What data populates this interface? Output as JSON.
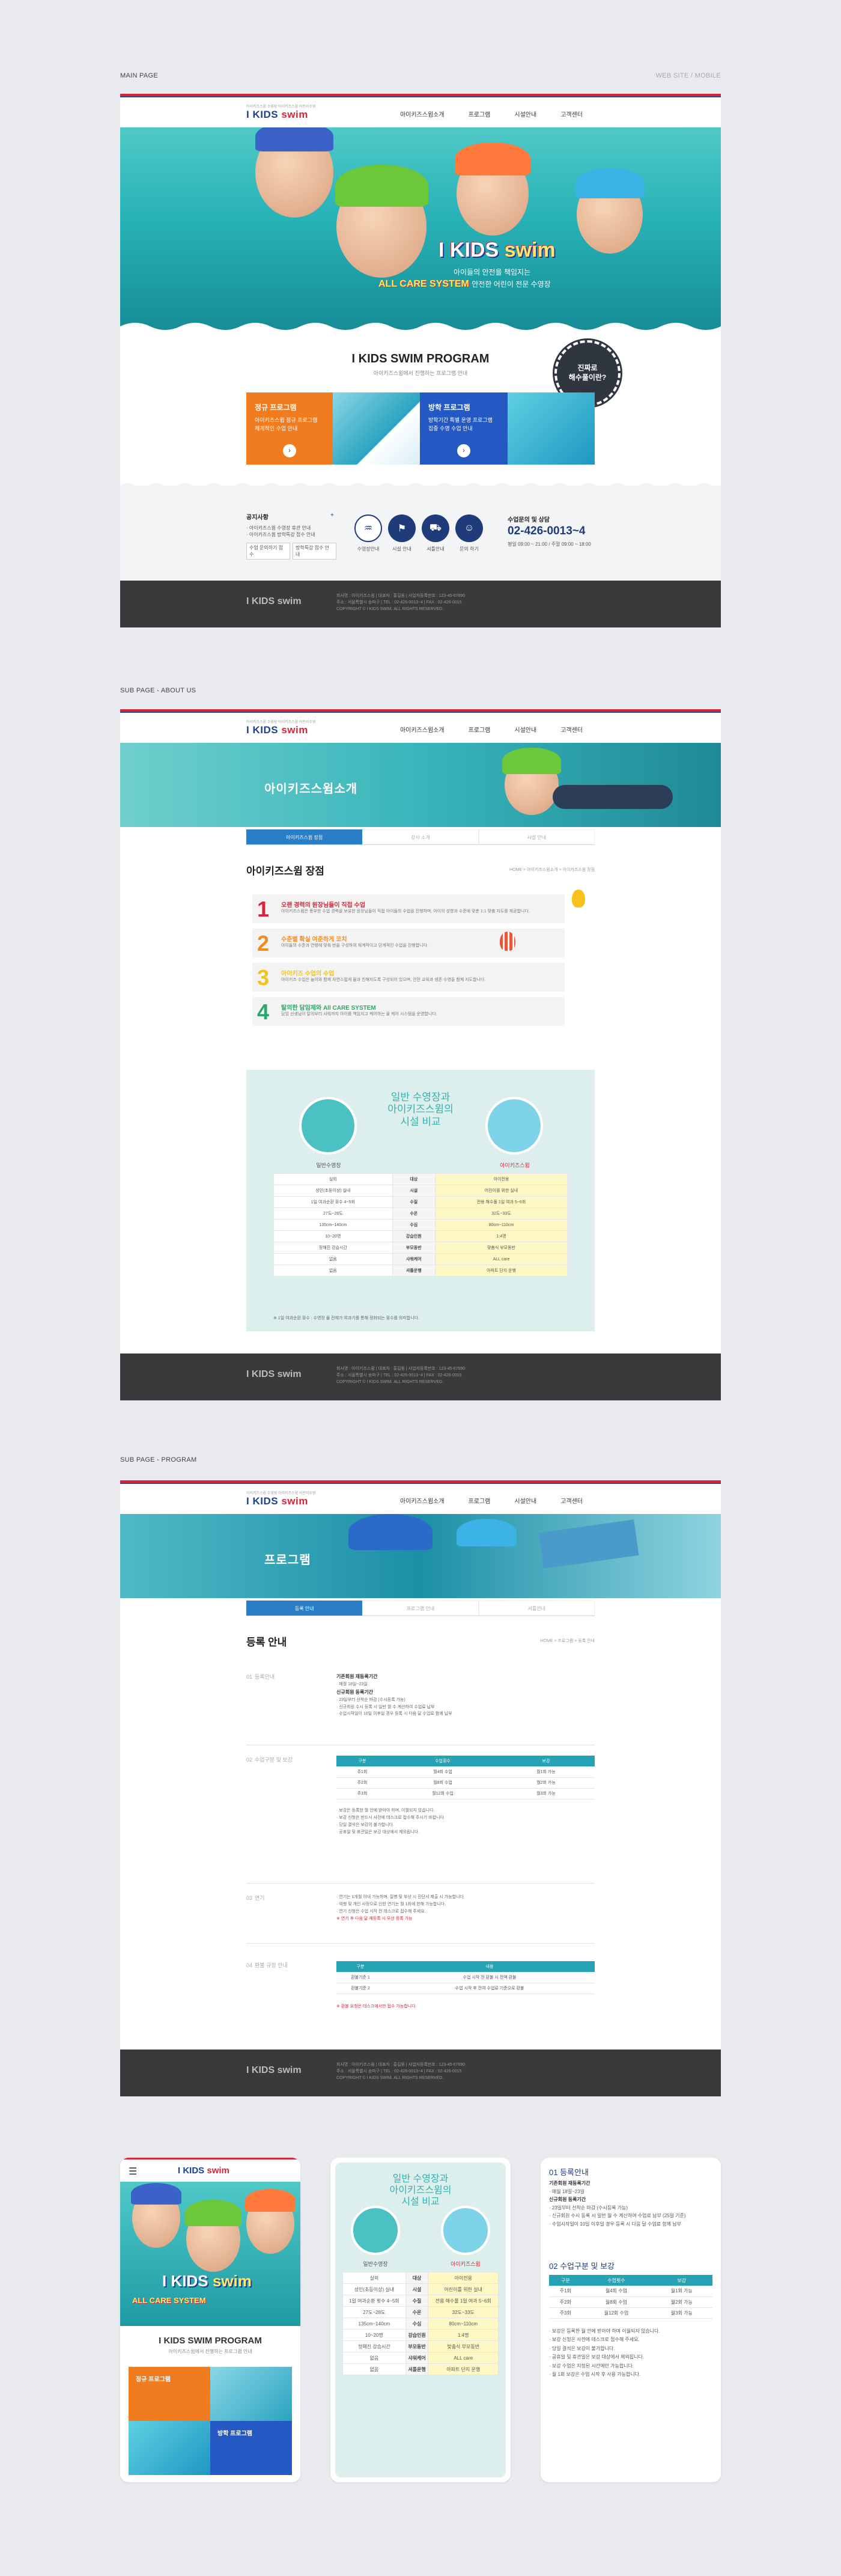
{
  "sections": {
    "main_label": "MAIN PAGE",
    "main_right": "WEB SITE / MOBILE",
    "about_label": "SUB PAGE - ABOUT US",
    "program_label": "SUB PAGE - PROGRAM"
  },
  "header": {
    "logo_small": "아이키즈스윔 수영장 아이키즈스윔 어린이수영",
    "logo_i": "I",
    "logo_kids": "KIDS",
    "logo_swim": "swim",
    "nav": [
      "아이키즈스윔소개",
      "프로그램",
      "시설안내",
      "고객센터"
    ]
  },
  "hero": {
    "brand_i": "I",
    "brand_kids": "KIDS",
    "brand_swim": "swim",
    "copy1": "아이들의 안전을 책임지는",
    "copy2_main": "ALL CARE SYSTEM",
    "copy2_sub": "안전한 어린이 전문 수영장"
  },
  "program": {
    "title": "I KIDS SWIM PROGRAM",
    "subtitle": "아이키즈스윔에서 진행하는 프로그램 안내",
    "badge": "진짜로\n해수풀이란?",
    "card1_title": "정규 프로그램",
    "card1_desc": "아이키즈스윔 정규 프로그램\n체계적인 수업 안내",
    "card2_title": "방학 프로그램",
    "card2_desc": "방학기간 특별 운영 프로그램\n집중 수영 수업 안내",
    "go": "›"
  },
  "info": {
    "notice_title": "공지사항",
    "notice_lines": [
      "· 아이키즈스윔 수영장 휴관 안내",
      "· 아이키즈스윔 방학특강 접수 안내"
    ],
    "notice_btn1": "수업 문의하기 접수",
    "notice_btn2": "방학특강 접수 안내",
    "quick": [
      {
        "icon": "swim-icon",
        "glyph": "♒",
        "label": "수영장안내"
      },
      {
        "icon": "flag-icon",
        "glyph": "⚑",
        "label": "시설 안내"
      },
      {
        "icon": "bus-icon",
        "glyph": "⛟",
        "label": "셔틀안내"
      },
      {
        "icon": "user-icon",
        "glyph": "☺",
        "label": "문의 하기"
      }
    ],
    "phone_label": "수업문의 및 상담",
    "phone": "02-426-0013~4",
    "phone_hours": "평일 09:00 ~ 21:00 / 주말 09:00 ~ 18:00"
  },
  "footer": {
    "logo": "I KIDS swim",
    "line1": "회사명 : 아이키즈스윔  |  대표자 : 홍길동  |  사업자등록번호 : 123-45-67890",
    "line2": "주소 : 서울특별시 송파구  |  TEL : 02-426-0013~4  |  FAX : 02-426-0015",
    "line3": "COPYRIGHT © I KIDS SWIM. ALL RIGHTS RESERVED."
  },
  "about": {
    "hero_title": "아이키즈스윔소개",
    "tabs": [
      "아이키즈스윔 장점",
      "강사 소개",
      "시설 안내"
    ],
    "page_title": "아이키즈스윔 장점",
    "crumb": "HOME > 아이키즈스윔소개 > 아이키즈스윔 장점",
    "steps": [
      {
        "n": "1",
        "title": "오랜 경력의 원장님들이 직접 수업",
        "desc": "아이키즈스윔은 풍부한 수업 경력을 보유한 원장님들이 직접 아이들의 수업을 진행하며, 아이의 성향과 수준에 맞춘 1:1 맞춤 지도를 제공합니다.",
        "color": "#d6263b"
      },
      {
        "n": "2",
        "title": "수준별 확실 여준하게 코치",
        "desc": "아이들의 수준과 연령에 맞춰 반을 구성하여 체계적이고 단계적인 수업을 진행합니다.",
        "color": "#f08c1e"
      },
      {
        "n": "3",
        "title": "아이키즈 수업의 수업",
        "desc": "아이키즈 수업은 놀이와 함께 자연스럽게 물과 친해지도록 구성되어 있으며, 안전 교육과 생존 수영을 함께 지도합니다.",
        "color": "#f5c21b"
      },
      {
        "n": "4",
        "title": "탈의한 담임제와 All CARE SYSTEM",
        "desc": "담임 선생님이 탈의부터 샤워까지 아이를 책임지고 케어하는 올 케어 시스템을 운영합니다.",
        "color": "#2aa76b"
      }
    ],
    "compare_title": "일반 수영장과\n아이키즈스윔의\n시설 비교",
    "left_label": "일반수영장",
    "right_label": "아이키즈스윔",
    "rows": [
      [
        "실외",
        "대상",
        "아이전용"
      ],
      [
        "성인(초등이상) 실내",
        "시설",
        "어린이를 위한 실내"
      ],
      [
        "1일 여과순환 횟수 4~5회",
        "수질",
        "전용 해수풀 1일 여과 5~6회"
      ],
      [
        "27도~28도",
        "수온",
        "32도~33도"
      ],
      [
        "135cm~140cm",
        "수심",
        "80cm~110cm"
      ],
      [
        "10~20명",
        "강습인원",
        "1:4명"
      ],
      [
        "정해진 강습시간",
        "부모동반",
        "맞춤식 부모동반"
      ],
      [
        "없음",
        "샤워케어",
        "ALL care"
      ],
      [
        "없음",
        "셔틀운행",
        "아파트 단지 운행"
      ]
    ],
    "compare_note": "※ 1일 여과순환 횟수 : 수영장 물 전체가 여과기를 통해 정화되는 횟수를 의미합니다."
  },
  "programPage": {
    "hero_title": "프로그램",
    "tabs": [
      "등록 안내",
      "프로그램 안내",
      "셔틀안내"
    ],
    "page_title": "등록 안내",
    "crumb": "HOME > 프로그램 > 등록 안내",
    "sec1_no": "01",
    "sec1": "등록안내",
    "sec1_lines": [
      "기존회원 재등록기간",
      "· 매월 18일~23일",
      "신규회원 등록기간",
      "· 23일부터 선착순 마감 (수시등록 가능)",
      "· 신규회원 수시 등록 시 일반 월 수 계산하여 수업료 납부",
      "· 수업시작일이 10일 이후일 경우 등록 시 다음 달 수업료 함께 납부"
    ],
    "sec2_no": "02",
    "sec2": "수업구분 및 보강",
    "table_head": [
      "구분",
      "수업횟수",
      "보강"
    ],
    "table_rows": [
      [
        "주1회",
        "월4회 수업",
        "월1회 가능"
      ],
      [
        "주2회",
        "월8회 수업",
        "월2회 가능"
      ],
      [
        "주3회",
        "월12회 수업",
        "월3회 가능"
      ]
    ],
    "sec2_lines": [
      "· 보강은 등록한 월 안에 받아야 하며, 이월되지 않습니다.",
      "· 보강 신청은 반드시 사전에 데스크로 접수해 주시기 바랍니다.",
      "· 당일 결석은 보강이 불가합니다.",
      "· 공휴일 및 휴관일은 보강 대상에서 제외됩니다."
    ],
    "sec3_no": "03",
    "sec3": "연기",
    "sec3_lines": [
      "· 연기는 1개월 이내 가능하며, 질병 및 부상 시 진단서 제출 시 가능합니다.",
      "· 여행 및 개인 사정으로 인한 연기는 월 1회에 한해 가능합니다.",
      "· 연기 신청은 수업 시작 전 데스크로 접수해 주세요.",
      "※ 연기 후 다음 달 재등록 시 우선 등록 가능"
    ],
    "sec4_no": "04",
    "sec4": "환불 규정 안내",
    "refund_head": [
      "구분",
      "내용"
    ],
    "refund_rows": [
      [
        "환불기준 1",
        "수업 시작 전 환불 시 전액 환불"
      ],
      [
        "환불기준 2",
        "수업 시작 후 잔여 수업료 기준으로 환불"
      ]
    ],
    "refund_note": "※ 환불 요청은 데스크에서만 접수 가능합니다."
  },
  "mobile": {
    "m1_program_title": "I KIDS SWIM PROGRAM",
    "m1_program_sub": "아이키즈스윔에서 진행하는 프로그램 안내",
    "m1_card1": "정규 프로그램",
    "m1_card2": "방학 프로그램",
    "m2_title": "일반 수영장과\n아이키즈스윔의\n시설 비교",
    "m2_left": "일반수영장",
    "m2_right": "아이키즈스윔",
    "m3_sec1": "01 등록안내",
    "m3_lines": [
      "기존회원 재등록기간",
      "· 매월 18일~23일",
      "신규회원 등록기간",
      "· 23일부터 선착순 마감 (수시등록 가능)",
      "· 신규회원 수시 등록 시 일반 월 수 계산하여 수업료 납부 (25일 기준)",
      "· 수업시작일이 10일 이후일 경우 등록 시 다음 달 수업료 함께 납부"
    ],
    "m3_sec2": "02 수업구분 및 보강",
    "m3_lines2": [
      "· 보강은 등록한 월 안에 받아야 하며 이월되지 않습니다.",
      "· 보강 신청은 사전에 데스크로 접수해 주세요.",
      "· 당일 결석은 보강이 불가합니다.",
      "· 공휴일 및 휴관일은 보강 대상에서 제외됩니다.",
      "· 보강 수업은 지정된 시간에만 가능합니다.",
      "· 월 1회 보강은 수업 시작 후 사용 가능합니다."
    ]
  },
  "colors": {
    "brand_blue": "#1c3f94",
    "brand_red": "#d6263b",
    "teal": "#34b1b1",
    "dark": "#3a3a3c"
  }
}
